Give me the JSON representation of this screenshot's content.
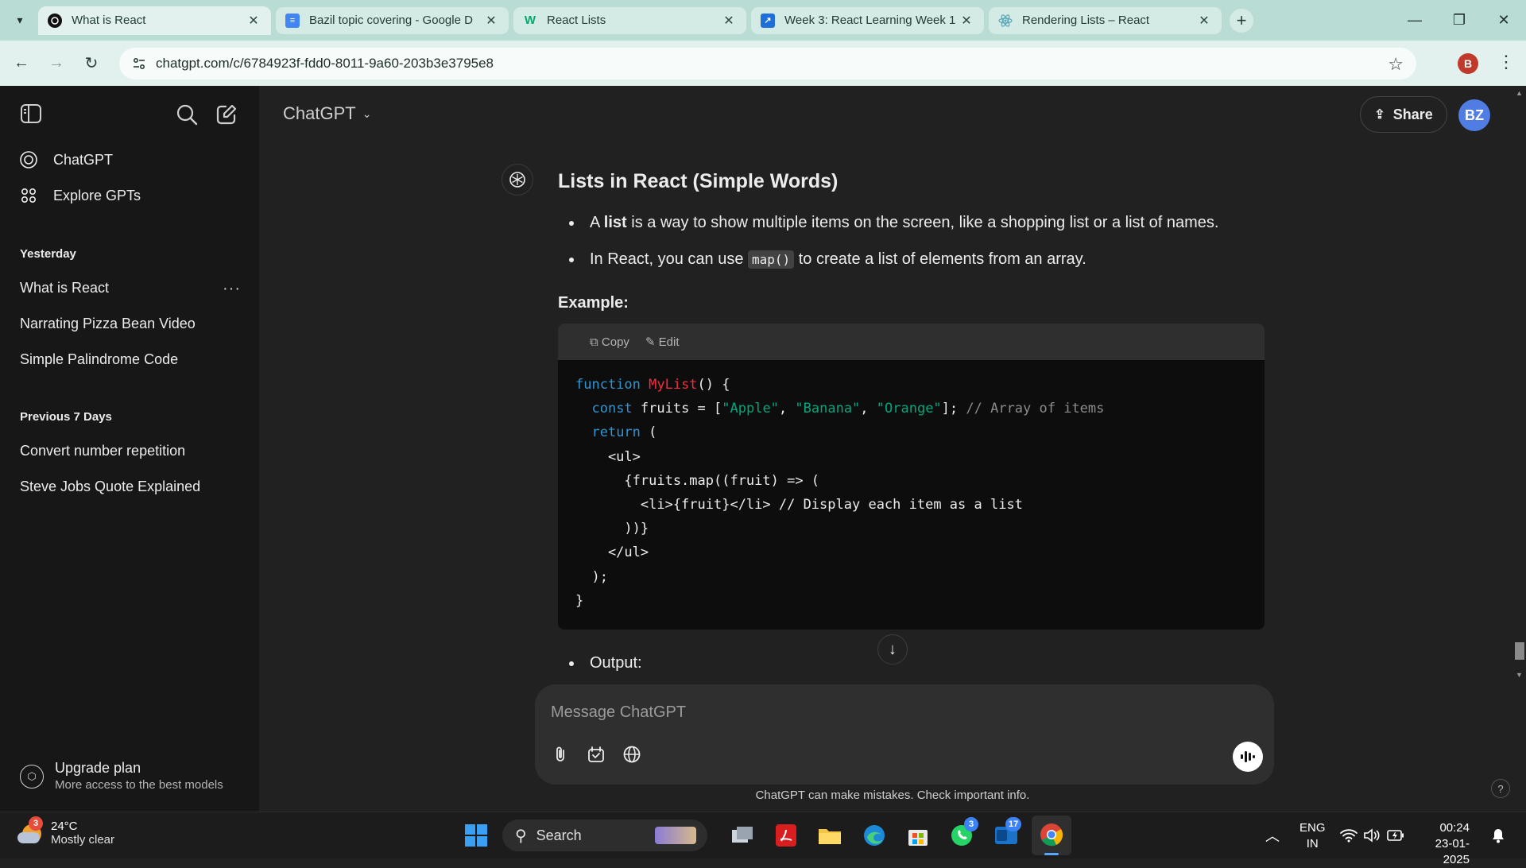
{
  "browser": {
    "tabs": [
      {
        "title": "What is React",
        "favicon": "chatgpt-icon",
        "active": true
      },
      {
        "title": "Bazil topic covering - Google D",
        "favicon": "google-docs-icon",
        "active": false
      },
      {
        "title": "React Lists",
        "favicon": "w3schools-icon",
        "active": false
      },
      {
        "title": "Week 3: React Learning Week 1",
        "favicon": "link-icon",
        "active": false
      },
      {
        "title": "Rendering Lists – React",
        "favicon": "react-icon",
        "active": false
      }
    ],
    "url": "chatgpt.com/c/6784923f-fdd0-8011-9a60-203b3e3795e8",
    "profile_initial": "B"
  },
  "sidebar": {
    "nav": [
      {
        "label": "ChatGPT",
        "icon": "chatgpt-logo-icon"
      },
      {
        "label": "Explore GPTs",
        "icon": "grid-icon"
      }
    ],
    "sections": [
      {
        "heading": "Yesterday",
        "items": [
          "What is React",
          "Narrating Pizza Bean Video",
          "Simple Palindrome Code"
        ]
      },
      {
        "heading": "Previous 7 Days",
        "items": [
          "Convert number repetition",
          "Steve Jobs Quote Explained"
        ]
      }
    ],
    "more_label": "···",
    "upgrade": {
      "title": "Upgrade plan",
      "subtitle": "More access to the best models"
    }
  },
  "header": {
    "model": "ChatGPT",
    "share_label": "Share",
    "avatar_initials": "BZ"
  },
  "message": {
    "heading": "Lists in React (Simple Words)",
    "bullet1": {
      "pre": "A ",
      "bold": "list",
      "post": " is a way to show multiple items on the screen, like a shopping list or a list of names."
    },
    "bullet2": {
      "pre": "In React, you can use ",
      "code": "map()",
      "post": " to create a list of elements from an array."
    },
    "example_label": "Example:",
    "code_block": {
      "language": "jsx",
      "copy_label": "Copy",
      "edit_label": "Edit",
      "lines": [
        [
          {
            "t": "function ",
            "c": "kw"
          },
          {
            "t": "MyList",
            "c": "fn"
          },
          {
            "t": "() {",
            "c": ""
          }
        ],
        [
          {
            "t": "  ",
            "c": ""
          },
          {
            "t": "const",
            "c": "kw"
          },
          {
            "t": " fruits = [",
            "c": ""
          },
          {
            "t": "\"Apple\"",
            "c": "str"
          },
          {
            "t": ", ",
            "c": ""
          },
          {
            "t": "\"Banana\"",
            "c": "str"
          },
          {
            "t": ", ",
            "c": ""
          },
          {
            "t": "\"Orange\"",
            "c": "str"
          },
          {
            "t": "]; ",
            "c": ""
          },
          {
            "t": "// Array of items",
            "c": "cm"
          }
        ],
        [
          {
            "t": "  ",
            "c": ""
          },
          {
            "t": "return",
            "c": "kw"
          },
          {
            "t": " (",
            "c": ""
          }
        ],
        [
          {
            "t": "    <ul>",
            "c": ""
          }
        ],
        [
          {
            "t": "      {fruits.map((fruit) => (",
            "c": ""
          }
        ],
        [
          {
            "t": "        <li>{fruit}</li> // Display each item as a list",
            "c": ""
          }
        ],
        [
          {
            "t": "      ))}",
            "c": ""
          }
        ],
        [
          {
            "t": "    </ul>",
            "c": ""
          }
        ],
        [
          {
            "t": "  );",
            "c": ""
          }
        ],
        [
          {
            "t": "}",
            "c": ""
          }
        ]
      ]
    },
    "output_label": "Output:"
  },
  "composer": {
    "placeholder": "Message ChatGPT",
    "disclaimer": "ChatGPT can make mistakes. Check important info.",
    "help_label": "?"
  },
  "taskbar": {
    "weather": {
      "temp": "24°C",
      "condition": "Mostly clear",
      "badge": "3"
    },
    "search_label": "Search",
    "whatsapp_badge": "3",
    "outlook_badge": "17",
    "language": [
      "ENG",
      "IN"
    ],
    "time": "00:24",
    "date": "23-01-2025"
  },
  "colors": {
    "tabstrip": "#b9dcd4",
    "sidebar_bg": "#171717",
    "main_bg": "#212121",
    "avatar": "#4f7de3",
    "code_keyword": "#2e95d3",
    "code_function": "#f22c3d",
    "code_string": "#00a67d"
  }
}
